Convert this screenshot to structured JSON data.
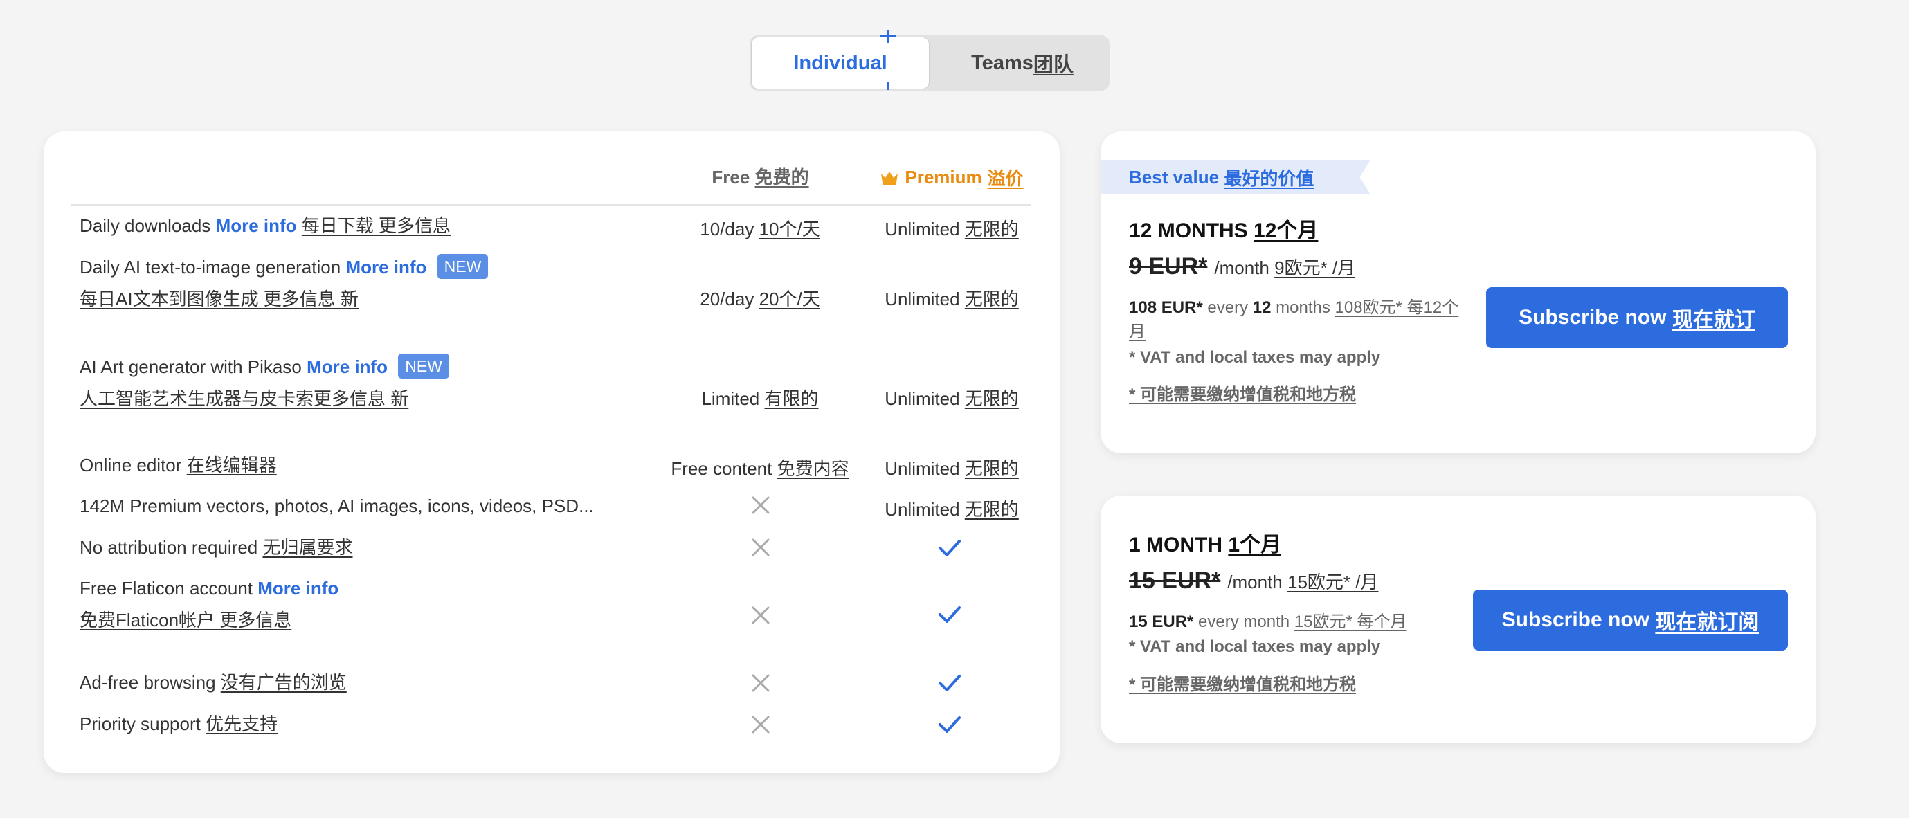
{
  "toggle": {
    "individual": "Individual",
    "teams": "Teams",
    "teams_cn": "团队"
  },
  "table": {
    "free_header": "Free",
    "free_header_cn": "免费的",
    "premium_header": "Premium",
    "premium_header_cn": "溢价",
    "rows": [
      {
        "label": "Daily downloads",
        "more": "More info",
        "cn": "每日下载 更多信息",
        "free": "10/day",
        "free_cn": "10个/天",
        "prem": "Unlimited",
        "prem_cn": "无限的"
      },
      {
        "label": "Daily AI text-to-image generation",
        "more": "More info",
        "badge": "NEW",
        "cn": "每日AI文本到图像生成 更多信息 新",
        "free": "20/day",
        "free_cn": "20个/天",
        "prem": "Unlimited",
        "prem_cn": "无限的"
      },
      {
        "label": "AI Art generator with Pikaso",
        "more": "More info",
        "badge": "NEW",
        "cn": "人工智能艺术生成器与皮卡索更多信息 新",
        "free": "Limited",
        "free_cn": "有限的",
        "prem": "Unlimited",
        "prem_cn": "无限的"
      },
      {
        "label": "Online editor",
        "cn": "在线编辑器",
        "free": "Free content",
        "free_cn": "免费内容",
        "prem": "Unlimited",
        "prem_cn": "无限的"
      },
      {
        "label": "142M Premium vectors, photos, AI images, icons, videos, PSD...",
        "prem": "Unlimited",
        "prem_cn": "无限的"
      },
      {
        "label": "No attribution required",
        "cn": "无归属要求"
      },
      {
        "label": "Free Flaticon account",
        "more": "More info",
        "cn": "免费Flaticon帐户 更多信息"
      },
      {
        "label": "Ad-free browsing",
        "cn": "没有广告的浏览"
      },
      {
        "label": "Priority support",
        "cn": "优先支持"
      }
    ]
  },
  "plan12": {
    "ribbon": "Best value",
    "ribbon_cn": "最好的价值",
    "title": "12 MONTHS",
    "title_cn": "12个月",
    "old_price": "9 EUR*",
    "per_month": "/month",
    "per_month_cn": "9欧元* /月",
    "bill_amount": "108 EUR*",
    "bill_every": "every",
    "bill_num": "12",
    "bill_unit": "months",
    "bill_cn": "108欧元* 每12个月",
    "vat": "* VAT and local taxes may apply",
    "vat_cn": "* 可能需要缴纳增值税和地方税",
    "button": "Subscribe now",
    "button_cn": "现在就订"
  },
  "plan1": {
    "title": "1 MONTH",
    "title_cn": "1个月",
    "old_price": "15 EUR*",
    "per_month": "/month",
    "per_month_cn": "15欧元* /月",
    "bill_amount": "15 EUR*",
    "bill_every": "every month",
    "bill_cn": "15欧元* 每个月",
    "vat": "* VAT and local taxes may apply",
    "vat_cn": "* 可能需要缴纳增值税和地方税",
    "button": "Subscribe now",
    "button_cn": "现在就订阅"
  },
  "colors": {
    "accent": "#2d6cdf",
    "premium": "#e98b0f",
    "badge": "#5b8fe6",
    "ribbon": "#e3ebfb"
  },
  "icons": {
    "premium": "crown-icon",
    "excluded": "x-icon",
    "included": "checkmark-icon"
  }
}
